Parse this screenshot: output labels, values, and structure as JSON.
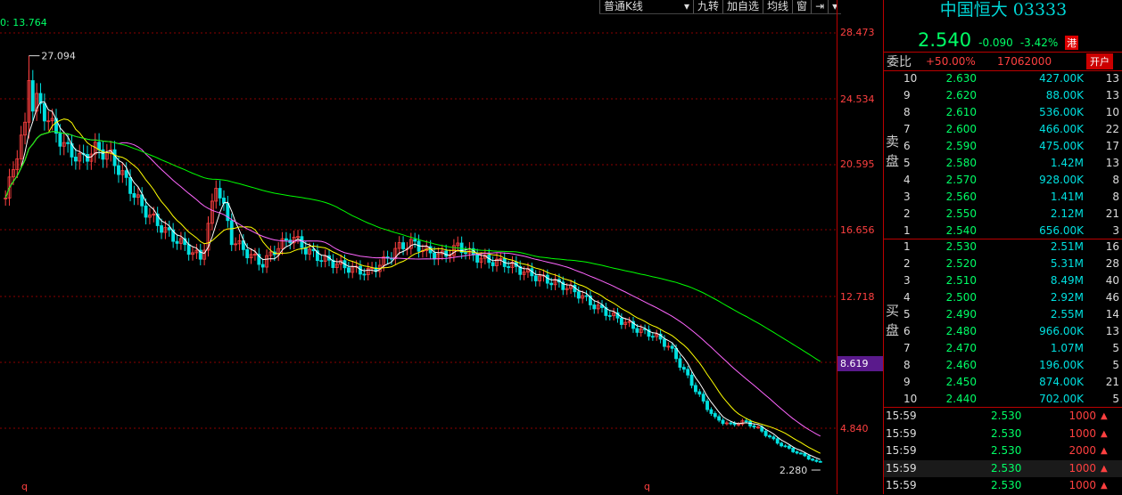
{
  "colors": {
    "up": "#ff4040",
    "down": "#00e0e0",
    "ma5": "#ffffff",
    "ma10": "#ffff00",
    "ma20": "#ff66ff",
    "ma60": "#00ff00",
    "grid": "#8b0000"
  },
  "chart": {
    "ma_label": "0: 13.764",
    "toolbar": [
      "普通K线",
      "九转",
      "加自选",
      "均线",
      "窗"
    ],
    "high_label": "27.094",
    "low_label": "2.280",
    "bottom_marks": [
      "q",
      "q"
    ],
    "current_price_tag": "8.619",
    "y_ticks": [
      "28.473",
      "24.534",
      "20.595",
      "16.656",
      "12.718",
      "8.619",
      "4.840"
    ]
  },
  "chart_data": {
    "type": "candlestick",
    "ylim": [
      2.28,
      28.473
    ],
    "high": 27.094,
    "low": 2.28,
    "close_trend": [
      18.5,
      22.0,
      24.5,
      23.0,
      21.5,
      20.8,
      21.5,
      21.0,
      19.5,
      18.0,
      17.0,
      16.2,
      15.5,
      14.8,
      19.5,
      16.0,
      15.2,
      14.5,
      15.5,
      16.2,
      15.3,
      14.8,
      14.5,
      14.2,
      14.0,
      14.6,
      15.5,
      15.8,
      15.2,
      15.0,
      15.6,
      15.0,
      14.7,
      14.6,
      14.2,
      13.8,
      13.5,
      13.2,
      12.7,
      12.0,
      11.5,
      11.0,
      10.5,
      10.2,
      9.5,
      8.0,
      6.5,
      5.2,
      4.8,
      5.0,
      4.5,
      3.8,
      3.3,
      2.9,
      2.4
    ]
  },
  "stock": {
    "name": "中国恒大 03333",
    "price": "2.540",
    "change": "-0.090",
    "change_pct": "-3.42%",
    "market_badge": "港",
    "webi_label": "委比",
    "webi_pct": "+50.00%",
    "webi_vol": "17062000",
    "open_account": "开户",
    "ask_label": [
      "卖",
      "盘"
    ],
    "bid_label": [
      "买",
      "盘"
    ]
  },
  "asks": [
    {
      "n": "10",
      "p": "2.630",
      "v": "427.00K",
      "c": "13"
    },
    {
      "n": "9",
      "p": "2.620",
      "v": "88.00K",
      "c": "13"
    },
    {
      "n": "8",
      "p": "2.610",
      "v": "536.00K",
      "c": "10"
    },
    {
      "n": "7",
      "p": "2.600",
      "v": "466.00K",
      "c": "22"
    },
    {
      "n": "6",
      "p": "2.590",
      "v": "475.00K",
      "c": "17"
    },
    {
      "n": "5",
      "p": "2.580",
      "v": "1.42M",
      "c": "13"
    },
    {
      "n": "4",
      "p": "2.570",
      "v": "928.00K",
      "c": "8"
    },
    {
      "n": "3",
      "p": "2.560",
      "v": "1.41M",
      "c": "8"
    },
    {
      "n": "2",
      "p": "2.550",
      "v": "2.12M",
      "c": "21"
    },
    {
      "n": "1",
      "p": "2.540",
      "v": "656.00K",
      "c": "3"
    }
  ],
  "bids": [
    {
      "n": "1",
      "p": "2.530",
      "v": "2.51M",
      "c": "16"
    },
    {
      "n": "2",
      "p": "2.520",
      "v": "5.31M",
      "c": "28"
    },
    {
      "n": "3",
      "p": "2.510",
      "v": "8.49M",
      "c": "40"
    },
    {
      "n": "4",
      "p": "2.500",
      "v": "2.92M",
      "c": "46"
    },
    {
      "n": "5",
      "p": "2.490",
      "v": "2.55M",
      "c": "14"
    },
    {
      "n": "6",
      "p": "2.480",
      "v": "966.00K",
      "c": "13"
    },
    {
      "n": "7",
      "p": "2.470",
      "v": "1.07M",
      "c": "5"
    },
    {
      "n": "8",
      "p": "2.460",
      "v": "196.00K",
      "c": "5"
    },
    {
      "n": "9",
      "p": "2.450",
      "v": "874.00K",
      "c": "21"
    },
    {
      "n": "10",
      "p": "2.440",
      "v": "702.00K",
      "c": "5"
    }
  ],
  "trades": [
    {
      "t": "15:59",
      "p": "2.530",
      "v": "1000"
    },
    {
      "t": "15:59",
      "p": "2.530",
      "v": "1000"
    },
    {
      "t": "15:59",
      "p": "2.530",
      "v": "2000"
    },
    {
      "t": "15:59",
      "p": "2.530",
      "v": "1000"
    },
    {
      "t": "15:59",
      "p": "2.530",
      "v": "1000"
    }
  ]
}
